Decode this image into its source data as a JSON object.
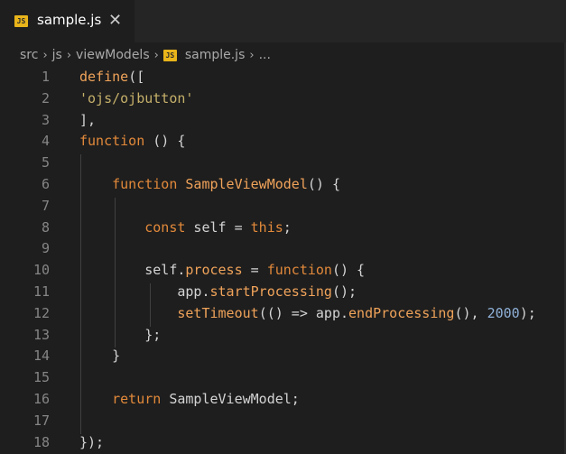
{
  "tab": {
    "badge": "JS",
    "label": "sample.js",
    "close": "✕"
  },
  "breadcrumb": {
    "items": [
      "src",
      "js",
      "viewModels",
      "sample.js",
      "..."
    ],
    "separator": "›",
    "badge": "JS"
  },
  "editor": {
    "line_numbers": [
      "1",
      "2",
      "3",
      "4",
      "5",
      "6",
      "7",
      "8",
      "9",
      "10",
      "11",
      "12",
      "13",
      "14",
      "15",
      "16",
      "17",
      "18"
    ],
    "lines": [
      [
        [
          "fn",
          "define"
        ],
        [
          "pun",
          "(["
        ]
      ],
      [
        [
          "str",
          "'ojs/ojbutton'"
        ]
      ],
      [
        [
          "pun",
          "],"
        ]
      ],
      [
        [
          "kw",
          "function"
        ],
        [
          "plain",
          " () {"
        ]
      ],
      [],
      [
        [
          "plain",
          "    "
        ],
        [
          "kw",
          "function"
        ],
        [
          "plain",
          " "
        ],
        [
          "fn",
          "SampleViewModel"
        ],
        [
          "plain",
          "() {"
        ]
      ],
      [],
      [
        [
          "plain",
          "        "
        ],
        [
          "kw",
          "const"
        ],
        [
          "plain",
          " self = "
        ],
        [
          "kw",
          "this"
        ],
        [
          "pun",
          ";"
        ]
      ],
      [],
      [
        [
          "plain",
          "        self."
        ],
        [
          "fn",
          "process"
        ],
        [
          "plain",
          " = "
        ],
        [
          "kw",
          "function"
        ],
        [
          "plain",
          "() {"
        ]
      ],
      [
        [
          "plain",
          "            app."
        ],
        [
          "fn",
          "startProcessing"
        ],
        [
          "plain",
          "();"
        ]
      ],
      [
        [
          "plain",
          "            "
        ],
        [
          "fn",
          "setTimeout"
        ],
        [
          "plain",
          "(() => app."
        ],
        [
          "fn",
          "endProcessing"
        ],
        [
          "plain",
          "(), "
        ],
        [
          "num",
          "2000"
        ],
        [
          "pun",
          ");"
        ]
      ],
      [
        [
          "plain",
          "        };"
        ]
      ],
      [
        [
          "plain",
          "    }"
        ]
      ],
      [],
      [
        [
          "plain",
          "    "
        ],
        [
          "kw",
          "return"
        ],
        [
          "plain",
          " SampleViewModel;"
        ]
      ],
      [],
      [
        [
          "plain",
          "});"
        ]
      ]
    ]
  }
}
